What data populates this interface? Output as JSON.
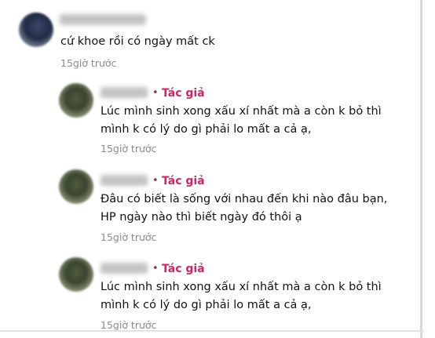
{
  "comments": [
    {
      "text_lines": [
        "cứ khoe rồi có ngày mất ck"
      ],
      "time": "15giờ trước"
    }
  ],
  "replies": [
    {
      "separator": "•",
      "author_badge": "Tác giả",
      "text_lines": [
        "Lúc mình sinh xong xấu xí nhất mà a còn k bỏ thì",
        "mình k có lý do gì phải lo mất a cả ạ,"
      ],
      "time": "15giờ trước"
    },
    {
      "separator": "•",
      "author_badge": "Tác giả",
      "text_lines": [
        "Đâu có biết là sống với nhau đến khi nào đâu bạn,",
        "HP ngày nào thì biết ngày đó thôi ạ"
      ],
      "time": "15giờ trước"
    },
    {
      "separator": "•",
      "author_badge": "Tác giả",
      "text_lines": [
        "Lúc mình sinh xong xấu xí nhất mà a còn k bỏ thì",
        "mình k có lý do gì phải lo mất a cả ạ,"
      ],
      "time": "15giờ trước"
    }
  ]
}
